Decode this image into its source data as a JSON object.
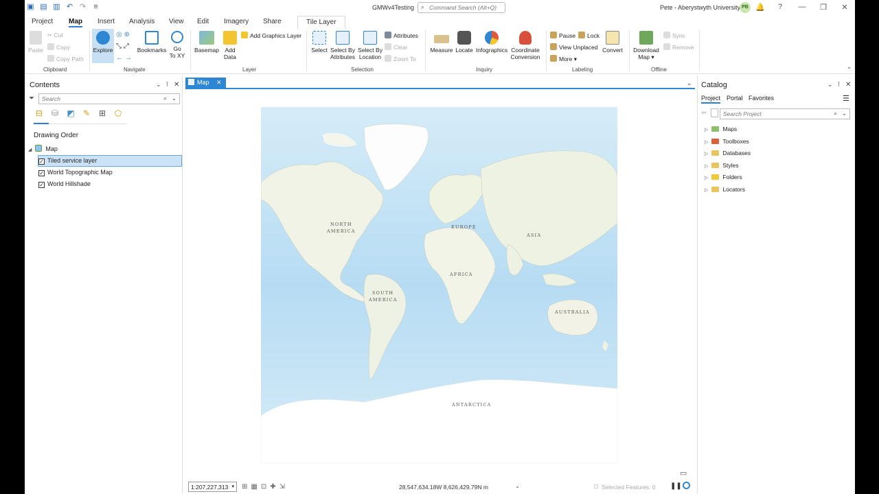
{
  "app": {
    "title": "GMWv4Testing",
    "command_search_placeholder": "Command Search (Alt+Q)",
    "user": "Pete - Aberystwyth University",
    "user_initials": "PB"
  },
  "tabs": [
    "Project",
    "Map",
    "Insert",
    "Analysis",
    "View",
    "Edit",
    "Imagery",
    "Share"
  ],
  "active_tab": "Map",
  "context_tab": "Tile Layer",
  "ribbon": {
    "clipboard": {
      "label": "Clipboard",
      "paste": "Paste",
      "cut": "Cut",
      "copy": "Copy",
      "copy_path": "Copy Path"
    },
    "navigate": {
      "label": "Navigate",
      "explore": "Explore",
      "bookmarks": "Bookmarks",
      "go_to_xy_1": "Go",
      "go_to_xy_2": "To XY"
    },
    "layer": {
      "label": "Layer",
      "basemap": "Basemap",
      "add_data_1": "Add",
      "add_data_2": "Data",
      "add_graphics_layer": "Add Graphics Layer"
    },
    "selection": {
      "label": "Selection",
      "select": "Select",
      "select_by_attributes_1": "Select By",
      "select_by_attributes_2": "Attributes",
      "select_by_location_1": "Select By",
      "select_by_location_2": "Location",
      "attributes": "Attributes",
      "clear": "Clear",
      "zoom_to": "Zoom To"
    },
    "inquiry": {
      "label": "Inquiry",
      "measure": "Measure",
      "locate": "Locate",
      "infographics": "Infographics",
      "coordinate_conversion_1": "Coordinate",
      "coordinate_conversion_2": "Conversion"
    },
    "labeling": {
      "label": "Labeling",
      "pause": "Pause",
      "lock": "Lock",
      "view_unplaced": "View Unplaced",
      "more": "More",
      "convert": "Convert"
    },
    "offline": {
      "label": "Offline",
      "download_map_1": "Download",
      "download_map_2": "Map",
      "sync": "Sync",
      "remove": "Remove"
    }
  },
  "contents": {
    "title": "Contents",
    "search_placeholder": "Search",
    "drawing_order": "Drawing Order",
    "map_name": "Map",
    "layers": [
      {
        "name": "Tiled service layer",
        "checked": true
      },
      {
        "name": "World Topographic Map",
        "checked": true
      },
      {
        "name": "World Hillshade",
        "checked": true
      }
    ]
  },
  "map_view": {
    "tab_label": "Map",
    "labels": {
      "north_america_1": "NORTH",
      "north_america_2": "AMERICA",
      "europe": "EUROPE",
      "asia": "ASIA",
      "africa": "AFRICA",
      "south_america_1": "SOUTH",
      "south_america_2": "AMERICA",
      "australia": "AUSTRALIA",
      "antarctica": "ANTARCTICA"
    },
    "scale": "1:207,227,313",
    "coordinates": "28,547,634.18W 8,626,429.79N m",
    "selected_features": "Selected Features: 0"
  },
  "catalog": {
    "title": "Catalog",
    "tabs": [
      "Project",
      "Portal",
      "Favorites"
    ],
    "active_tab": "Project",
    "search_placeholder": "Search Project",
    "items": [
      "Maps",
      "Toolboxes",
      "Databases",
      "Styles",
      "Folders",
      "Locators"
    ]
  },
  "colors": {
    "accent": "#2f86d3",
    "ocean": "#bfe1f5",
    "land": "#f1f4ea",
    "ice": "#ffffff",
    "selection": "#cce3f7"
  }
}
